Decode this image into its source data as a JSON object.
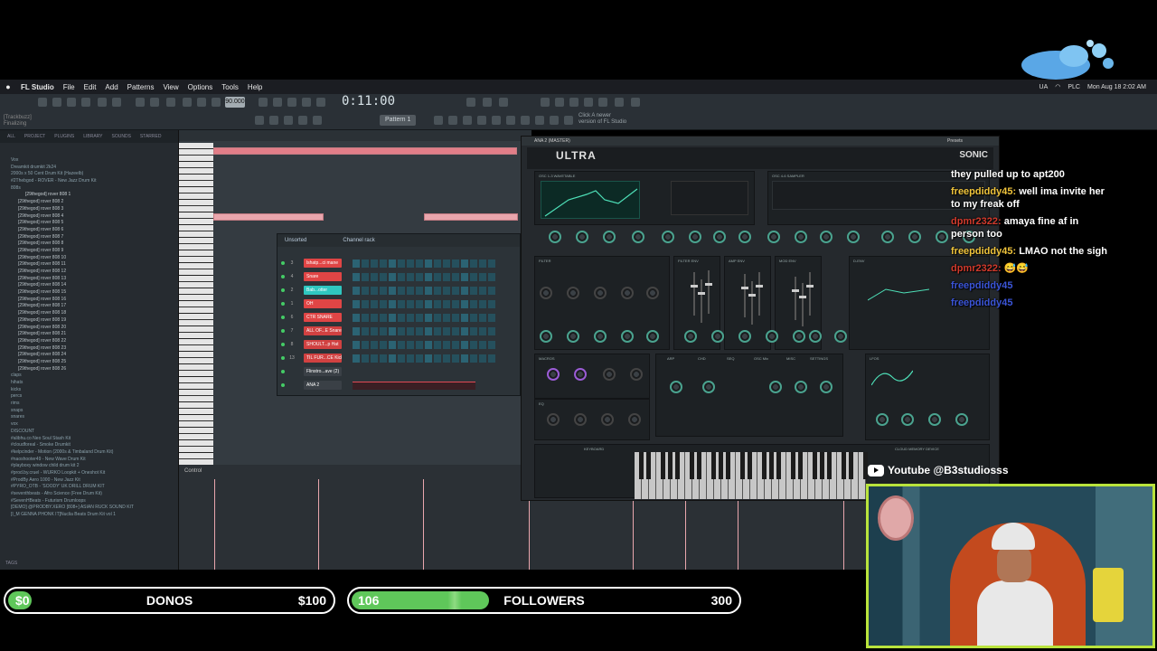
{
  "menubar": {
    "app": "FL Studio",
    "items": [
      "File",
      "Edit",
      "Add",
      "Patterns",
      "View",
      "Options",
      "Tools",
      "Help"
    ],
    "status_right": [
      "UA",
      "PLC"
    ],
    "clock": "Mon Aug 18  2:02 AM"
  },
  "toolbar": {
    "time": "0:11:00",
    "tempo": "90.000",
    "pattern": "Pattern 1",
    "hint_line1": "Click  A newer",
    "hint_line2": "version of FL Studio",
    "status_line1": "[Trackbuzz]",
    "status_line2": "Finalizing"
  },
  "browser": {
    "tabs": [
      "ALL",
      "PROJECT",
      "PLUGINS",
      "LIBRARY",
      "SOUNDS",
      "STARRED"
    ],
    "items": [
      {
        "t": "Vox",
        "k": "f"
      },
      {
        "t": "Dreamkit drumkit 2k24",
        "k": "f"
      },
      {
        "t": "2000s x 50 Cent Drum Kit (Hazeelb)",
        "k": "f"
      },
      {
        "t": "#2Thebgod - ROVER - New Jazz Drum Kit",
        "k": "f"
      },
      {
        "t": "808s",
        "k": "f"
      },
      {
        "t": "[29thegod] rover 808 1",
        "k": "s"
      },
      {
        "t": "[29thegod] rover 808 2",
        "k": "i"
      },
      {
        "t": "[29thegod] rover 808 3",
        "k": "i"
      },
      {
        "t": "[29thegod] rover 808 4",
        "k": "i"
      },
      {
        "t": "[29thegod] rover 808 5",
        "k": "i"
      },
      {
        "t": "[29thegod] rover 808 6",
        "k": "i"
      },
      {
        "t": "[29thegod] rover 808 7",
        "k": "i"
      },
      {
        "t": "[29thegod] rover 808 8",
        "k": "i"
      },
      {
        "t": "[29thegod] rover 808 9",
        "k": "i"
      },
      {
        "t": "[29thegod] rover 808 10",
        "k": "i"
      },
      {
        "t": "[29thegod] rover 808 11",
        "k": "i"
      },
      {
        "t": "[29thegod] rover 808 12",
        "k": "i"
      },
      {
        "t": "[29thegod] rover 808 13",
        "k": "i"
      },
      {
        "t": "[29thegod] rover 808 14",
        "k": "i"
      },
      {
        "t": "[29thegod] rover 808 15",
        "k": "i"
      },
      {
        "t": "[29thegod] rover 808 16",
        "k": "i"
      },
      {
        "t": "[29thegod] rover 808 17",
        "k": "i"
      },
      {
        "t": "[29thegod] rover 808 18",
        "k": "i"
      },
      {
        "t": "[29thegod] rover 808 19",
        "k": "i"
      },
      {
        "t": "[29thegod] rover 808 20",
        "k": "i"
      },
      {
        "t": "[29thegod] rover 808 21",
        "k": "i"
      },
      {
        "t": "[29thegod] rover 808 22",
        "k": "i"
      },
      {
        "t": "[29thegod] rover 808 23",
        "k": "i"
      },
      {
        "t": "[29thegod] rover 808 24",
        "k": "i"
      },
      {
        "t": "[29thegod] rover 808 25",
        "k": "i"
      },
      {
        "t": "[29thegod] rover 808 26",
        "k": "i"
      },
      {
        "t": "claps",
        "k": "f"
      },
      {
        "t": "hihats",
        "k": "f"
      },
      {
        "t": "kicks",
        "k": "f"
      },
      {
        "t": "percs",
        "k": "f"
      },
      {
        "t": "rims",
        "k": "f"
      },
      {
        "t": "snaps",
        "k": "f"
      },
      {
        "t": "snares",
        "k": "f"
      },
      {
        "t": "vox",
        "k": "f"
      },
      {
        "t": "DISCOUNT",
        "k": "f"
      },
      {
        "t": "#alibhu.co Neo Soul Stash Kit",
        "k": "f"
      },
      {
        "t": "#cloudforeal - Smoke Drumkit",
        "k": "f"
      },
      {
        "t": "#kelpcinder - Motion (2000s & Timbaland Drum Kit)",
        "k": "f"
      },
      {
        "t": "#naoshooter49 - New Wave Drum Kit",
        "k": "f"
      },
      {
        "t": "#playboxy window child drum kit 2",
        "k": "f"
      },
      {
        "t": "#prod.by.cruel - WURKO Loopkit + Oneshot Kit",
        "k": "f"
      },
      {
        "t": "#ProdBy Aero 1000 - New Jazz Kit",
        "k": "f"
      },
      {
        "t": "#PYRO_OTB - 'SOODY' UK DRILL DRUM KIT",
        "k": "f"
      },
      {
        "t": "#seventhbeats - Afro Science (Free Drum Kit)",
        "k": "f"
      },
      {
        "t": "#SevenHBeats - Futurism Drumloops",
        "k": "f"
      },
      {
        "t": "[DEMO] @PRODBY.XERO [808+] ASIAN RUCK SOUND KIT",
        "k": "f"
      },
      {
        "t": "[I_M GENNA PHONK IT]Nuclia Beats Drum Kit vol 1",
        "k": "f"
      }
    ],
    "tags": "TAGS"
  },
  "rack": {
    "title": "Channel rack",
    "filter": "Unsorted",
    "channels": [
      {
        "n": "3",
        "name": "lshatp...ci mane",
        "c": "#e04545"
      },
      {
        "n": "4",
        "name": "Snare",
        "c": "#e04545"
      },
      {
        "n": "2",
        "name": "Bab...otter",
        "c": "#2fc7c0"
      },
      {
        "n": "1",
        "name": "OH",
        "c": "#e04545"
      },
      {
        "n": "6",
        "name": "CTR SNARE",
        "c": "#e04545"
      },
      {
        "n": "7",
        "name": "ALL OF...E Snare",
        "c": "#d14141"
      },
      {
        "n": "8",
        "name": "SHOULT...p Hat",
        "c": "#d14141"
      },
      {
        "n": "13",
        "name": "TIL FUR...CE Kick",
        "c": "#d14141"
      },
      {
        "n": "",
        "name": "Flinstro...ave (2)",
        "c": "#3a4046"
      },
      {
        "n": "",
        "name": "ANA 2",
        "c": "#3a4046"
      }
    ]
  },
  "playlist": {
    "control_label": "Control"
  },
  "synth": {
    "window_title": "ANA 2 (MASTER)",
    "presets": "Presets",
    "logo": "ULTRA",
    "brand": "SONIC",
    "osc_a": "OSC 1-3 WAVETABLE",
    "osc_b": "OSC 4-6 SAMPLER",
    "filter": "FILTER",
    "filter_env": "FILTER ENV",
    "amp_env": "AMP ENV",
    "mod_env": "MOD ENV",
    "d_env": "D-ENV",
    "macros": "MACROS",
    "eq": "EQ",
    "keyboard": "KEYBOARD",
    "lfos": "LFOS",
    "footer": "CLOUD MEMORY DEVICE",
    "fx_tabs": [
      "ARP",
      "CHD",
      "SEQ",
      "OSC Mix",
      "MISC",
      "SETTINGS"
    ]
  },
  "chat": [
    {
      "user": "",
      "msg": "they pulled up to apt200",
      "uc": "r"
    },
    {
      "user": "freepdiddy45:",
      "msg": "well ima invite her to my freak off",
      "uc": "y"
    },
    {
      "user": "dpmr2322:",
      "msg": "amaya fine af in person too",
      "uc": "r"
    },
    {
      "user": "freepdiddy45:",
      "msg": "LMAO not the sigh",
      "uc": "y"
    },
    {
      "user": "dpmr2322:",
      "msg": "😅😅",
      "uc": "r"
    },
    {
      "user": "freepdiddy45",
      "msg": "",
      "uc": "b"
    },
    {
      "user": "freepdiddy45",
      "msg": "",
      "uc": "b"
    }
  ],
  "overlay": {
    "youtube": "Youtube @B3studiosss"
  },
  "donos": {
    "current": "$0",
    "label": "DONOS",
    "goal": "$100",
    "progress": 0.0
  },
  "followers": {
    "current": "106",
    "label": "FOLLOWERS",
    "goal": "300",
    "progress": 0.353
  },
  "colors": {
    "accent": "#4aa38f",
    "goal_fill": "#5fc75a",
    "cam_border": "#b9e33c"
  }
}
